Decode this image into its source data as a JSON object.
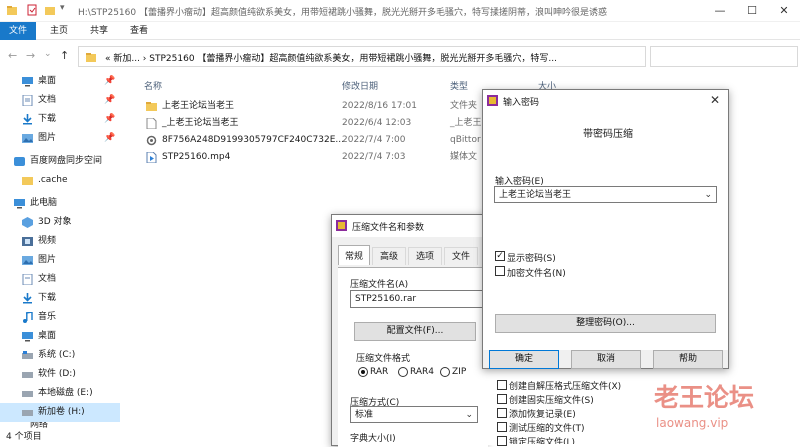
{
  "window": {
    "title": "H:\\STP25160 【蕾播界小瘤动】超高颜值纯欲系美女，用带短裙跳小骚舞，脱光光掰开多毛骚穴，特写揉搓阴蒂，浪叫呻吟很是诱惑",
    "minimize": "—",
    "maximize": "☐",
    "close": "✕"
  },
  "ribbon": {
    "tabs": [
      "文件",
      "主页",
      "共享",
      "查看"
    ]
  },
  "navbar": {
    "address": "«  新加...  ›  STP25160 【蕾播界小瘤动】超高颜值纯欲系美女，用带短裙跳小骚舞，脱光光掰开多毛骚穴，特写...",
    "back": "←",
    "forward": "→",
    "down": "⌄",
    "up": "↑"
  },
  "navpane": {
    "quick_access": [
      {
        "label": "桌面",
        "pin": "📌"
      },
      {
        "label": "文档",
        "pin": "📌"
      },
      {
        "label": "下载",
        "pin": "📌"
      },
      {
        "label": "图片",
        "pin": "📌"
      }
    ],
    "cloud": "百度网盘同步空间",
    "cache": ".cache",
    "this_pc": "此电脑",
    "pc_items": [
      "3D 对象",
      "视频",
      "图片",
      "文档",
      "下载",
      "音乐",
      "桌面",
      "系统 (C:)",
      "软件 (D:)",
      "本地磁盘 (E:)",
      "新加卷 (H:)"
    ],
    "network": "网络"
  },
  "filelist": {
    "headers": {
      "name": "名称",
      "date": "修改日期",
      "type": "类型",
      "size": "大小"
    },
    "rows": [
      {
        "name": "上老王论坛当老王",
        "date": "2022/8/16 17:01",
        "type": "文件夹",
        "icon": "folder-icon"
      },
      {
        "name": "_上老王论坛当老王",
        "date": "2022/6/4 12:03",
        "type": "_上老王",
        "icon": "file-icon"
      },
      {
        "name": "8F756A248D9199305797CF240C732E...",
        "date": "2022/7/4 7:00",
        "type": "qBittor",
        "icon": "settings-file-icon"
      },
      {
        "name": "STP25160.mp4",
        "date": "2022/7/4 7:03",
        "type": "媒体文",
        "icon": "video-file-icon"
      }
    ]
  },
  "status": {
    "count": "4 个项目"
  },
  "archive_dialog": {
    "title": "压缩文件名和参数",
    "tabs": [
      "常规",
      "高级",
      "选项",
      "文件"
    ],
    "archive_name_label": "压缩文件名(A)",
    "archive_name_value": "STP25160.rar",
    "config_button": "配置文件(F)...",
    "format_label": "压缩文件格式",
    "formats": [
      "RAR",
      "RAR4",
      "ZIP"
    ],
    "selected_format": "RAR",
    "method_label": "压缩方式(C)",
    "method_value": "标准",
    "dict_label": "字典大小(I)",
    "options": [
      {
        "label": "创建自解压格式压缩文件(X)",
        "checked": false
      },
      {
        "label": "创建固实压缩文件(S)",
        "checked": false
      },
      {
        "label": "添加恢复记录(E)",
        "checked": false
      },
      {
        "label": "测试压缩的文件(T)",
        "checked": false
      },
      {
        "label": "锁定压缩文件(L)",
        "checked": false
      }
    ]
  },
  "password_dialog": {
    "title": "输入密码",
    "heading": "带密码压缩",
    "password_label": "输入密码(E)",
    "password_value": "上老王论坛当老王",
    "show_password": {
      "label": "显示密码(S)",
      "checked": true
    },
    "encrypt_names": {
      "label": "加密文件名(N)",
      "checked": false
    },
    "organize_button": "整理密码(O)...",
    "ok": "确定",
    "cancel": "取消",
    "help": "帮助",
    "close": "✕"
  },
  "watermark": {
    "big": "老王论坛",
    "small": "laowang.vip"
  },
  "colors": {
    "accent": "#1979ca",
    "selection": "#cce8ff",
    "folder": "#f3c95a",
    "watermark": "#e8857a"
  }
}
